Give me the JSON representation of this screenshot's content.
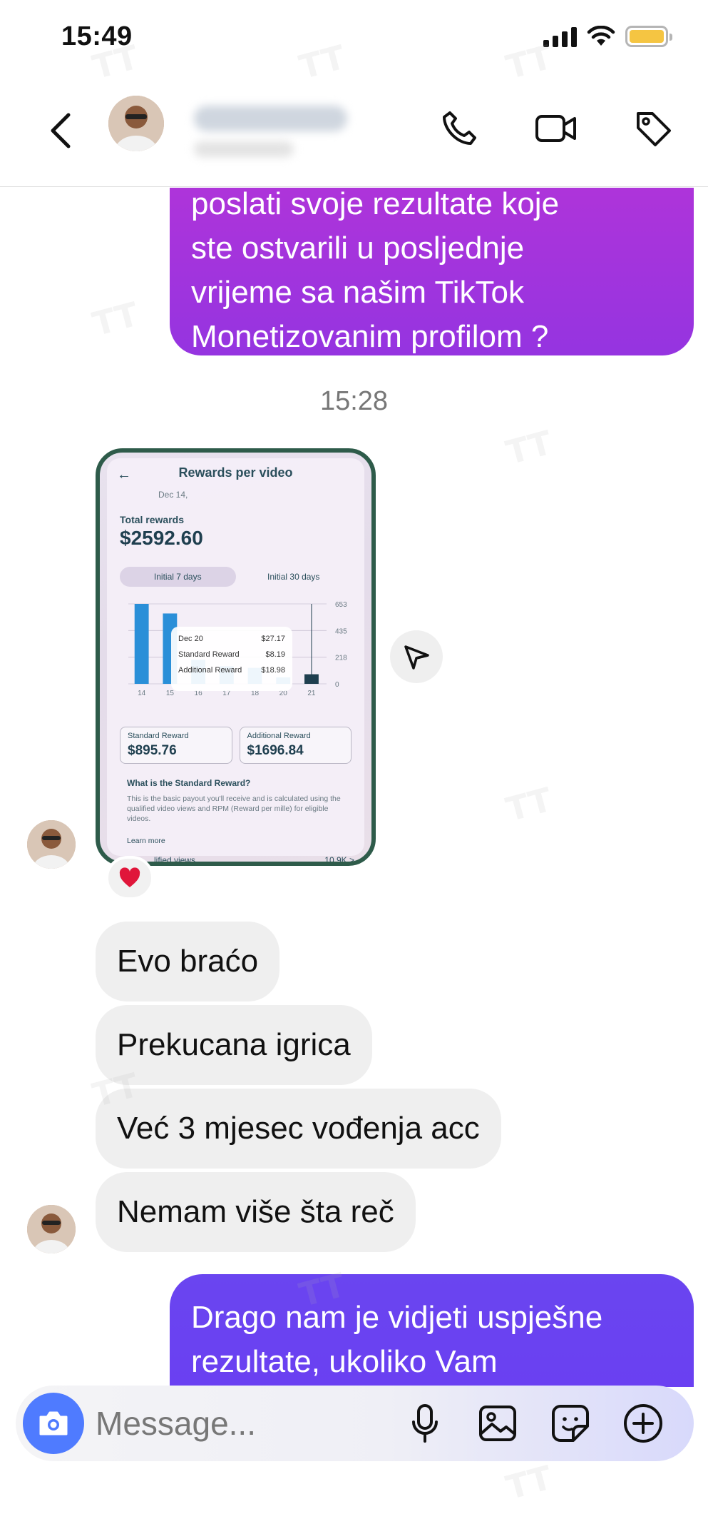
{
  "status_bar": {
    "time": "15:49"
  },
  "watermark": "TT",
  "messages": {
    "outgoing_top_lines": [
      "poslati svoje rezultate koje",
      "ste ostvarili u posljednje",
      "vrijeme sa našim TikTok",
      "Monetizovanim profilom ?"
    ],
    "timestamp": "15:28",
    "photo": {
      "title": "Rewards per video",
      "date": "Dec 14,",
      "total_label": "Total rewards",
      "total_value": "$2592.60",
      "tabs": [
        "Initial 7 days",
        "Initial 30 days"
      ],
      "y_ticks": [
        "653",
        "435",
        "218",
        "0"
      ],
      "x_ticks": [
        "14",
        "15",
        "16",
        "17",
        "18",
        "20",
        "21"
      ],
      "bar_values": [
        100,
        88,
        30,
        22,
        20,
        8,
        12
      ],
      "tooltip": {
        "date": "Dec 20",
        "total": "$27.17",
        "standard_label": "Standard Reward",
        "standard_value": "$8.19",
        "additional_label": "Additional Reward",
        "additional_value": "$18.98"
      },
      "standard_label": "Standard Reward",
      "standard_value": "$895.76",
      "additional_label": "Additional Reward",
      "additional_value": "$1696.84",
      "question": "What is the Standard Reward?",
      "description": "This is the basic payout you'll receive and is calculated using the qualified video views and RPM (Reward per mille) for eligible videos.",
      "learn_more": "Learn more",
      "views_label": "...lified views",
      "views_value": "10.9K >"
    },
    "reaction": "❤️",
    "incoming": [
      "Evo braćo",
      "Prekucana igrica",
      "Već 3 mjesec vođenja acc",
      "Nemam više šta reč"
    ],
    "outgoing_bottom_lines": [
      "Drago nam je vidjeti uspješne",
      "rezultate, ukoliko Vam"
    ]
  },
  "composer": {
    "placeholder": "Message..."
  },
  "colors": {
    "outgoing_top": "#a234dd",
    "outgoing_bottom": "#6a42f1",
    "incoming": "#efefef",
    "camera": "#4f7bff"
  }
}
